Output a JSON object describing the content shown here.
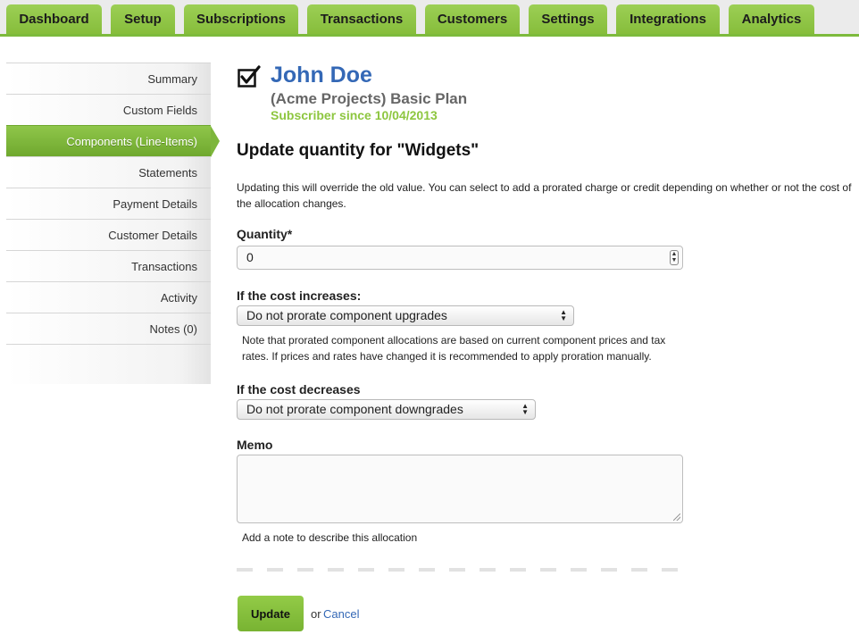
{
  "nav": {
    "tabs": [
      "Dashboard",
      "Setup",
      "Subscriptions",
      "Transactions",
      "Customers",
      "Settings",
      "Integrations",
      "Analytics"
    ],
    "accent_color": "#8dc63f"
  },
  "sidebar": {
    "items": [
      "Summary",
      "Custom Fields",
      "Components (Line-Items)",
      "Statements",
      "Payment Details",
      "Customer Details",
      "Transactions",
      "Activity",
      "Notes (0)"
    ],
    "active_index": 2
  },
  "customer": {
    "name": "John Doe",
    "plan": "(Acme Projects) Basic Plan",
    "since": "Subscriber since 10/04/2013",
    "name_color": "#3468b6"
  },
  "form": {
    "title": "Update quantity for \"Widgets\"",
    "description": "Updating this will override the old value. You can select to add a prorated charge or credit depending on whether or not the cost of the allocation changes.",
    "quantity_label": "Quantity*",
    "quantity_value": "0",
    "increase_label": "If the cost increases:",
    "increase_selected": "Do not prorate component upgrades",
    "increase_note": "Note that prorated component allocations are based on current component prices and tax rates. If prices and rates have changed it is recommended to apply proration manually.",
    "decrease_label": "If the cost decreases",
    "decrease_selected": "Do not prorate component downgrades",
    "memo_label": "Memo",
    "memo_value": "",
    "memo_help": "Add a note to describe this allocation",
    "update_label": "Update",
    "or_text": "or",
    "cancel_label": "Cancel"
  }
}
